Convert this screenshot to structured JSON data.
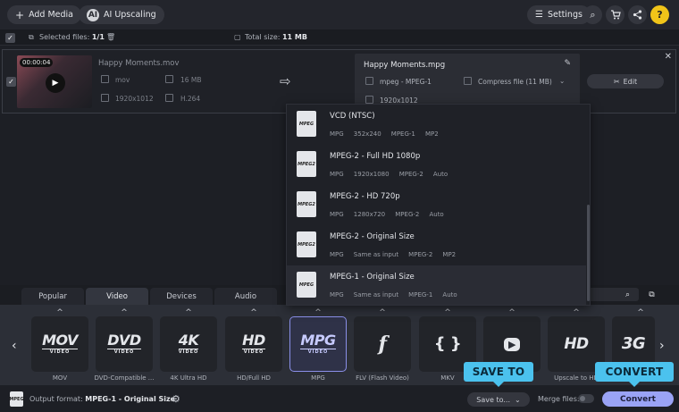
{
  "topbar": {
    "add_media": "Add Media",
    "ai_upscaling": "AI Upscaling",
    "settings": "Settings"
  },
  "filebar": {
    "selected_label": "Selected files:",
    "selected_value": "1/1",
    "total_label": "Total size:",
    "total_value": "11 MB"
  },
  "file": {
    "duration": "00:00:04",
    "source_name": "Happy Moments.mov",
    "source_format": "mov",
    "source_size": "16 MB",
    "source_resolution": "1920x1012",
    "source_codec": "H.264",
    "output_name": "Happy Moments.mpg",
    "output_format": "mpeg - MPEG-1",
    "compress": "Compress file (11 MB)",
    "output_resolution": "1920x1012",
    "edit": "Edit"
  },
  "presets": [
    {
      "title": "VCD (NTSC)",
      "specs": "MPG     352x240     MPEG-1     MP2",
      "icon": "MPEG"
    },
    {
      "title": "MPEG-2 - Full HD 1080p",
      "specs": "MPG     1920x1080     MPEG-2     Auto",
      "icon": "MPEG2"
    },
    {
      "title": "MPEG-2 - HD 720p",
      "specs": "MPG     1280x720     MPEG-2     Auto",
      "icon": "MPEG2"
    },
    {
      "title": "MPEG-2  - Original Size",
      "specs": "MPG     Same as input     MPEG-2     MP2",
      "icon": "MPEG2"
    },
    {
      "title": "MPEG-1  - Original Size",
      "specs": "MPG     Same as input     MPEG-1     Auto",
      "icon": "MPEG"
    }
  ],
  "tabs": [
    "Popular",
    "Video",
    "Devices",
    "Audio"
  ],
  "formats": [
    {
      "logo": "MOV",
      "sub": "VIDEO",
      "label": "MOV"
    },
    {
      "logo": "DVD",
      "sub": "VIDEO",
      "label": "DVD-Compatible ..."
    },
    {
      "logo": "4K",
      "sub": "VIDEO",
      "label": "4K Ultra HD"
    },
    {
      "logo": "HD",
      "sub": "VIDEO",
      "label": "HD/Full HD"
    },
    {
      "logo": "MPG",
      "sub": "VIDEO",
      "label": "MPG"
    },
    {
      "logo": "f",
      "sub": "",
      "label": "FLV (Flash Video)"
    },
    {
      "logo": "{ }",
      "sub": "",
      "label": "MKV"
    },
    {
      "logo": "▶",
      "sub": "",
      "label": ""
    },
    {
      "logo": "HD",
      "sub": "",
      "label": "Upscale to HD"
    },
    {
      "logo": "3G",
      "sub": "",
      "label": ""
    }
  ],
  "bottom": {
    "output_label": "Output format:",
    "output_value": "MPEG-1  - Original Size",
    "save_to": "Save to...",
    "merge": "Merge files:",
    "convert": "Convert"
  },
  "callouts": {
    "save_to": "SAVE TO",
    "convert": "CONVERT"
  },
  "colors": {
    "accent": "#9aa3f5",
    "callout": "#4bc2ee",
    "background": "#1d1f25"
  }
}
